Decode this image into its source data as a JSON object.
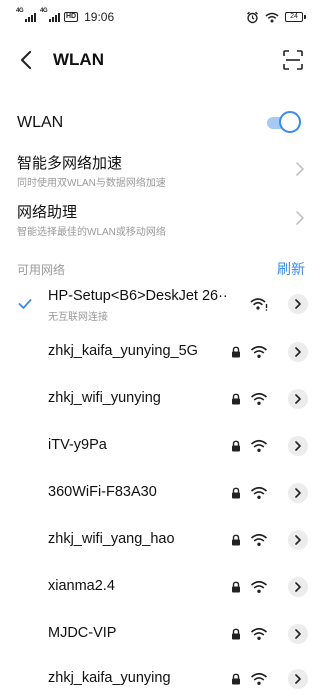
{
  "status_bar": {
    "sim1": "4G",
    "sim2": "4G",
    "hd": "HD",
    "time": "19:06",
    "battery": "24"
  },
  "header": {
    "title": "WLAN"
  },
  "wlan_toggle": {
    "label": "WLAN",
    "enabled": true
  },
  "settings": [
    {
      "title": "智能多网络加速",
      "subtitle": "同时使用双WLAN与数据网络加速"
    },
    {
      "title": "网络助理",
      "subtitle": "智能选择最佳的WLAN或移动网络"
    }
  ],
  "available": {
    "label": "可用网络",
    "refresh": "刷新"
  },
  "networks": [
    {
      "ssid": "HP-Setup<B6>DeskJet 26··",
      "status": "无互联网连接",
      "connected": true,
      "locked": false
    },
    {
      "ssid": "zhkj_kaifa_yunying_5G",
      "locked": true
    },
    {
      "ssid": "zhkj_wifi_yunying",
      "locked": true
    },
    {
      "ssid": "iTV-y9Pa",
      "locked": true
    },
    {
      "ssid": "360WiFi-F83A30",
      "locked": true
    },
    {
      "ssid": "zhkj_wifi_yang_hao",
      "locked": true
    },
    {
      "ssid": "xianma2.4",
      "locked": true
    },
    {
      "ssid": "MJDC-VIP",
      "locked": true
    },
    {
      "ssid": "zhkj_kaifa_yunying",
      "locked": true
    }
  ],
  "colors": {
    "accent": "#3b8bea",
    "secondary_text": "#9a9a9a"
  }
}
